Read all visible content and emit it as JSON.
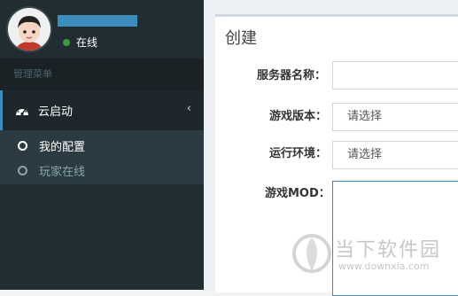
{
  "user": {
    "status": "在线",
    "status_color": "#3c9a3c",
    "name_color": "#3c8dbc"
  },
  "sidebar": {
    "header": "管理菜单",
    "active_item": {
      "label": "云启动",
      "icon": "dashboard-icon",
      "chevron": "‹"
    },
    "subitems": [
      {
        "label": "我的配置",
        "active": true
      },
      {
        "label": "玩家在线",
        "active": false
      }
    ]
  },
  "form": {
    "title": "创建",
    "fields": [
      {
        "label": "服务器名称：",
        "value": ""
      },
      {
        "label": "游戏版本：",
        "value": "请选择"
      },
      {
        "label": "运行环境：",
        "value": "请选择"
      },
      {
        "label": "游戏MOD：",
        "value": ""
      }
    ]
  },
  "watermark": {
    "name": "当下软件园",
    "url": "www.downxia.com"
  },
  "colors": {
    "sidebar_bg": "#222d32",
    "accent": "#3c8dbc"
  }
}
